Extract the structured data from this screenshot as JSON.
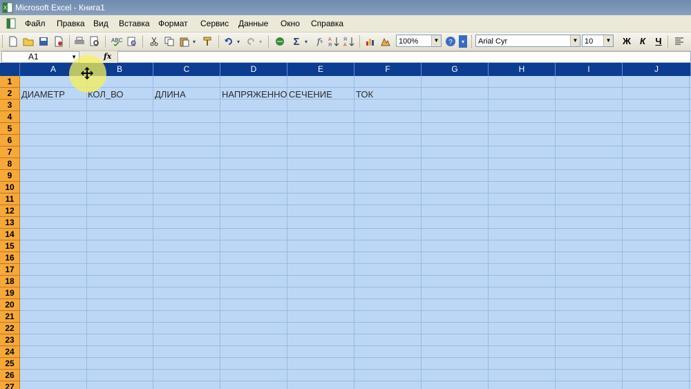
{
  "window": {
    "title": "Microsoft Excel - Книга1"
  },
  "menu": [
    "Файл",
    "Правка",
    "Вид",
    "Вставка",
    "Формат",
    "Сервис",
    "Данные",
    "Окно",
    "Справка"
  ],
  "toolbar": {
    "zoom": "100%",
    "font": "Arial Cyr",
    "font_size": "10",
    "bold": "Ж",
    "italic": "К",
    "underline": "Ч"
  },
  "formula_bar": {
    "name_box": "A1",
    "fx": "fx",
    "formula": ""
  },
  "columns": [
    "A",
    "B",
    "C",
    "D",
    "E",
    "F",
    "G",
    "H",
    "I",
    "J"
  ],
  "rows": [
    "1",
    "2",
    "3",
    "4",
    "5",
    "6",
    "7",
    "8",
    "9",
    "10",
    "11",
    "12",
    "13",
    "14",
    "15",
    "16",
    "17",
    "18",
    "19",
    "20",
    "21",
    "22",
    "23",
    "24",
    "25",
    "26",
    "27"
  ],
  "cells": {
    "A2": "ДИАМЕТР",
    "B2": "КОЛ_ВО",
    "C2": "ДЛИНА",
    "D2": "НАПРЯЖЕННО",
    "E2": "СЕЧЕНИЕ",
    "F2": "ТОК"
  },
  "colors": {
    "header_blue": "#0b3d91",
    "row_header_orange": "#f6a838",
    "sheet_fill": "#bcd7f5"
  }
}
